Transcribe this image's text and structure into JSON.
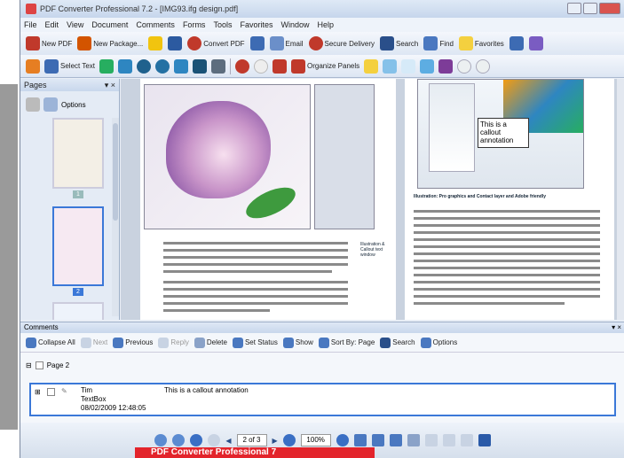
{
  "window": {
    "title": "PDF Converter Professional 7.2 - [IMG93.ifg design.pdf]"
  },
  "menu": [
    "File",
    "Edit",
    "View",
    "Document",
    "Comments",
    "Forms",
    "Tools",
    "Favorites",
    "Window",
    "Help"
  ],
  "toolbar1": {
    "new_pdf": "New PDF",
    "new_package": "New Package...",
    "convert_pdf": "Convert PDF",
    "email": "Email",
    "secure_delivery": "Secure Delivery",
    "search": "Search",
    "find": "Find",
    "favorites": "Favorites"
  },
  "toolbar2": {
    "select_text": "Select Text",
    "organize_panels": "Organize Panels"
  },
  "pages_panel": {
    "title": "Pages",
    "options": "Options",
    "thumb_numbers": [
      "1",
      "2"
    ]
  },
  "document": {
    "callout_text": "This is a callout annotation",
    "caption_left": "Illustration & Callout text window",
    "caption_right": "Illustration: Pro graphics and Contact layer and Adobe friendly"
  },
  "comments_panel": {
    "title": "Comments",
    "toolbar": [
      "Collapse All",
      "Next",
      "Previous",
      "Reply",
      "Delete",
      "Set Status",
      "Show",
      "Sort By: Page",
      "Search",
      "Options"
    ],
    "page_label": "Page 2",
    "comment": {
      "author": "Tim",
      "type": "TextBox",
      "date": "08/02/2009 12:48:05",
      "text": "This is a callout annotation"
    }
  },
  "bottombar": {
    "page_indicator": "2 of 3",
    "zoom": "100%"
  },
  "banner": "PDF Converter Professional 7"
}
